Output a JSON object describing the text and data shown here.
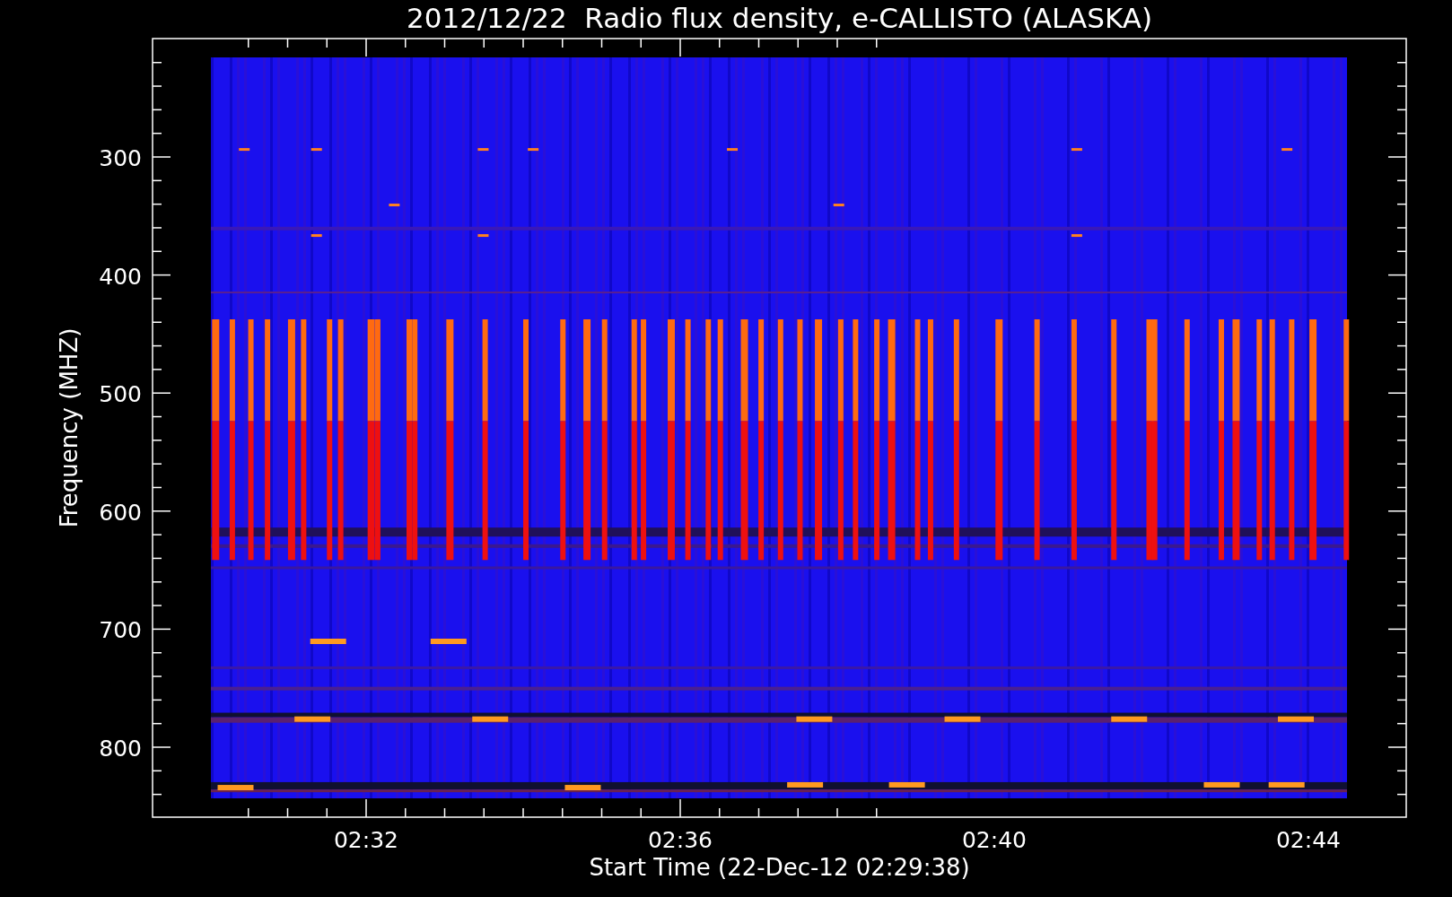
{
  "title": "2012/12/22  Radio flux density, e-CALLISTO (ALASKA)",
  "plot": {
    "xlabel": "Start Time (22-Dec-12 02:29:38)",
    "ylabel": "Frequency (MHZ)",
    "xticks": [
      "02:32",
      "02:36",
      "02:40",
      "02:44"
    ],
    "yticks": [
      "300",
      "400",
      "500",
      "600",
      "700",
      "800"
    ]
  }
}
